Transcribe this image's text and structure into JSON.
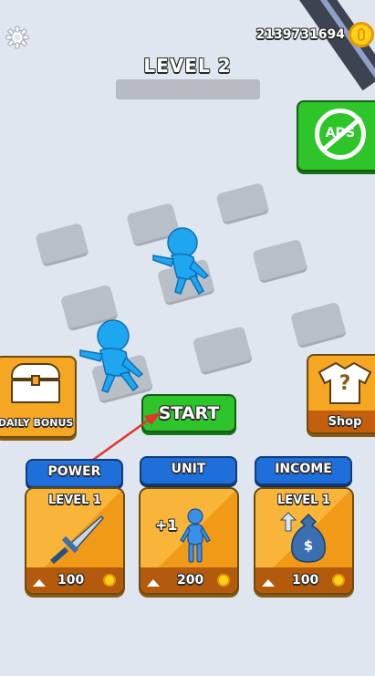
{
  "hud": {
    "coins": "2139731694",
    "level_label": "LEVEL 2",
    "level_progress": 0,
    "no_ads_label": "ADS"
  },
  "side": {
    "daily_bonus_label": "DAILY BONUS",
    "shop_label": "Shop",
    "shop_glyph": "?"
  },
  "start_label": "START",
  "upgrades": [
    {
      "tab": "POWER",
      "level": "LEVEL 1",
      "cost": "100"
    },
    {
      "tab": "UNIT",
      "badge": "+1",
      "cost": "200"
    },
    {
      "tab": "INCOME",
      "level": "LEVEL 1",
      "cost": "100",
      "bag_glyph": "$"
    }
  ],
  "colors": {
    "accent_blue": "#1e6fd9",
    "start_green": "#2ec52a",
    "card_orange": "#f5a623",
    "character_blue": "#1ea6f0"
  }
}
